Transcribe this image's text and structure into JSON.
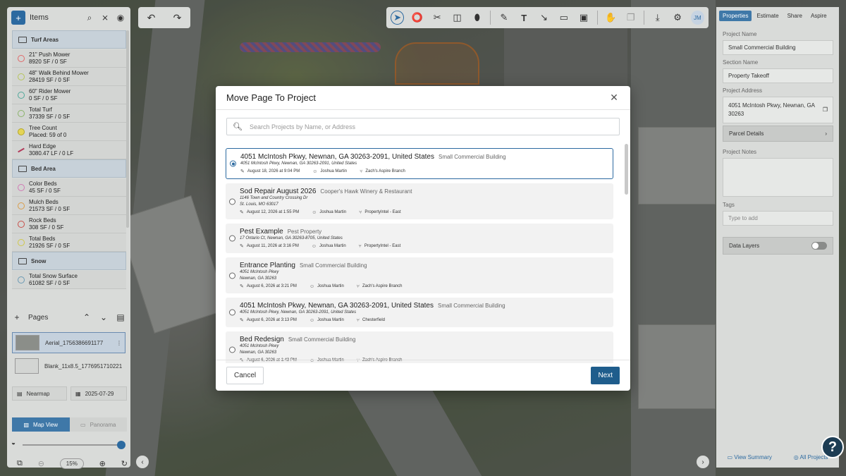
{
  "left_panel": {
    "title": "Items",
    "groups": [
      {
        "label": "Turf Areas",
        "items": [
          {
            "name": "21\" Push Mower",
            "value": "8920 SF / 0 SF",
            "color": "#e06a6a"
          },
          {
            "name": "48\" Walk Behind Mower",
            "value": "28419 SF / 0 SF",
            "color": "#b6c45a"
          },
          {
            "name": "60\" Rider Mower",
            "value": "0 SF / 0 SF",
            "color": "#4fa89a"
          },
          {
            "name": "Total Turf",
            "value": "37339 SF / 0 SF",
            "color": "#8bb36a"
          },
          {
            "name": "Tree Count",
            "value": "Placed: 59 of 0",
            "color": "#d7c84a"
          },
          {
            "name": "Hard Edge",
            "value": "3080.47 LF / 0 LF",
            "color": "#b23a5a"
          }
        ]
      },
      {
        "label": "Bed Area",
        "items": [
          {
            "name": "Color Beds",
            "value": "45 SF / 0 SF",
            "color": "#d07ab4"
          },
          {
            "name": "Mulch Beds",
            "value": "21573 SF / 0 SF",
            "color": "#d99d4a"
          },
          {
            "name": "Rock Beds",
            "value": "308 SF / 0 SF",
            "color": "#c8504a"
          },
          {
            "name": "Total Beds",
            "value": "21926 SF / 0 SF",
            "color": "#d0c84a"
          }
        ]
      },
      {
        "label": "Snow",
        "items": [
          {
            "name": "Total Snow Surface",
            "value": "61082 SF / 0 SF",
            "color": "#6a9ab4"
          }
        ]
      }
    ],
    "pages_label": "Pages",
    "pages": [
      {
        "name": "Aerial_1756386691177"
      },
      {
        "name": "Blank_11x8.5_1776951710221"
      }
    ],
    "source_label": "Nearmap",
    "date_label": "2025-07-29",
    "map_view_label": "Map View",
    "panorama_label": "Panorama",
    "zoom_label": "15%",
    "slider_fraction": 1.0
  },
  "toolbar": {
    "avatar_initials": "JM"
  },
  "right_panel": {
    "tabs": [
      "Properties",
      "Estimate",
      "Share",
      "Aspire"
    ],
    "project_name_label": "Project Name",
    "project_name_value": "Small Commercial Building",
    "section_name_label": "Section Name",
    "section_name_value": "Property Takeoff",
    "project_address_label": "Project Address",
    "project_address_value": "4051 McIntosh Pkwy, Newnan, GA 30263",
    "parcel_details_label": "Parcel Details",
    "project_notes_label": "Project Notes",
    "tags_label": "Tags",
    "tags_placeholder": "Type to add",
    "data_layers_label": "Data Layers",
    "view_summary_label": "View Summary",
    "all_projects_label": "All Projects"
  },
  "help_label": "?",
  "modal": {
    "title": "Move Page To Project",
    "search_placeholder": "Search Projects by Name, or Address",
    "cancel_label": "Cancel",
    "next_label": "Next",
    "projects": [
      {
        "name": "4051 McIntosh Pkwy, Newnan, GA 30263-2091, United States",
        "type": "Small Commercial Building",
        "address": "4051 McIntosh Pkwy, Newnan, GA 30263-2091, United States",
        "date": "August 18, 2026 at 9:04 PM",
        "user": "Joshua Martin",
        "branch": "Zach's Aspire Branch",
        "selected": true
      },
      {
        "name": "Sod Repair August 2026",
        "type": "Cooper's Hawk Winery & Restaurant",
        "address": "1146 Town and Country Crossing Dr\nSt. Louis, MO 63017",
        "date": "August 12, 2026 at 1:55 PM",
        "user": "Joshua Martin",
        "branch": "PropertyIntel - East",
        "selected": false
      },
      {
        "name": "Pest Example",
        "type": "Pest Property",
        "address": "17 Ontario Ct, Newnan, GA 30263-8705, United States",
        "date": "August 11, 2026 at 3:16 PM",
        "user": "Joshua Martin",
        "branch": "PropertyIntel - East",
        "selected": false
      },
      {
        "name": "Entrance Planting",
        "type": "Small Commercial Building",
        "address": "4051 McIntosh Pkwy\nNewnan, GA 30263",
        "date": "August 6, 2026 at 3:21 PM",
        "user": "Joshua Martin",
        "branch": "Zach's Aspire Branch",
        "selected": false
      },
      {
        "name": "4051 McIntosh Pkwy, Newnan, GA 30263-2091, United States",
        "type": "Small Commercial Building",
        "address": "4051 McIntosh Pkwy, Newnan, GA 30263-2091, United States",
        "date": "August 6, 2026 at 3:13 PM",
        "user": "Joshua Martin",
        "branch": "Chesterfield",
        "selected": false
      },
      {
        "name": "Bed Redesign",
        "type": "Small Commercial Building",
        "address": "4051 McIntosh Pkwy\nNewnan, GA 30263",
        "date": "August 6, 2026 at 1:43 PM",
        "user": "Joshua Martin",
        "branch": "Zach's Aspire Branch",
        "selected": false
      }
    ]
  }
}
